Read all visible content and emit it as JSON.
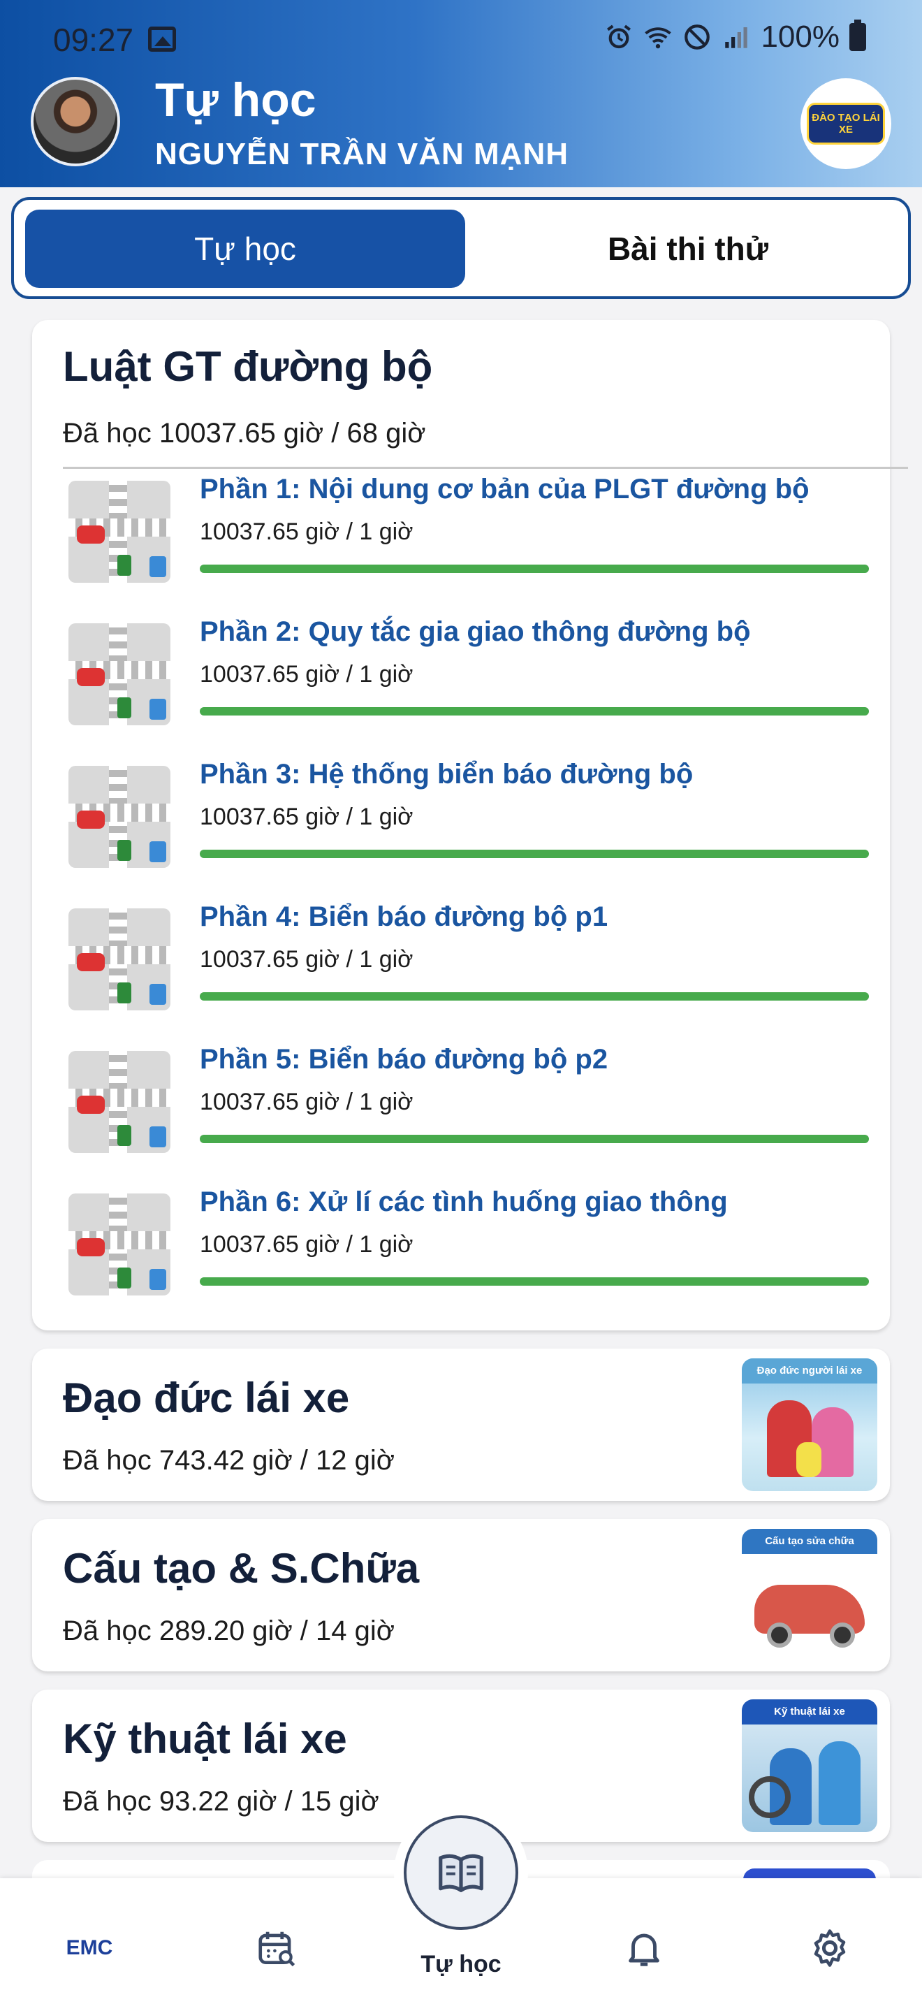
{
  "status_bar": {
    "time": "09:27",
    "battery": "100%"
  },
  "header": {
    "title": "Tự học",
    "user_name": "NGUYỄN TRẦN VĂN MẠNH",
    "logo_text": "ĐÀO TẠO LÁI XE"
  },
  "tabs": [
    {
      "label": "Tự học",
      "active": true
    },
    {
      "label": "Bài thi thử",
      "active": false
    }
  ],
  "sections": [
    {
      "title": "Luật GT đường bộ",
      "progress": "Đã học 10037.65 giờ / 68 giờ",
      "lessons": [
        {
          "title": "Phần 1: Nội dung cơ bản của PLGT đường bộ",
          "hours": "10037.65 giờ / 1 giờ",
          "progress": 1.0
        },
        {
          "title": "Phần 2: Quy tắc gia giao thông đường bộ",
          "hours": "10037.65 giờ / 1 giờ",
          "progress": 1.0
        },
        {
          "title": "Phần 3: Hệ thống biển báo đường bộ",
          "hours": "10037.65 giờ / 1 giờ",
          "progress": 1.0
        },
        {
          "title": "Phần 4: Biển báo đường bộ p1",
          "hours": "10037.65 giờ / 1 giờ",
          "progress": 1.0
        },
        {
          "title": "Phần 5: Biển báo đường bộ p2",
          "hours": "10037.65 giờ / 1 giờ",
          "progress": 1.0
        },
        {
          "title": "Phần 6: Xử lí các tình huống giao thông",
          "hours": "10037.65 giờ / 1 giờ",
          "progress": 1.0
        }
      ]
    },
    {
      "title": "Đạo đức lái xe",
      "progress": "Đã học 743.42 giờ / 12 giờ",
      "image_caption": "Đạo đức người lái xe"
    },
    {
      "title": "Cấu tạo & S.Chữa",
      "progress": "Đã học 289.20 giờ / 14 giờ",
      "image_caption": "Cấu tạo sửa chữa"
    },
    {
      "title": "Kỹ thuật lái xe",
      "progress": "Đã học 93.22 giờ / 15 giờ",
      "image_caption": "Kỹ thuật lái xe"
    }
  ],
  "bottom_nav": {
    "items": [
      {
        "icon": "emc-logo-icon",
        "logo_text": "EMC"
      },
      {
        "icon": "calendar-search-icon"
      },
      {
        "icon": "book-icon",
        "label": "Tự học",
        "active": true
      },
      {
        "icon": "bell-icon"
      },
      {
        "icon": "gear-icon"
      }
    ]
  },
  "colors": {
    "primary": "#1752a6",
    "progress_fill": "#47aa4c",
    "lesson_title": "#1a55a0"
  }
}
